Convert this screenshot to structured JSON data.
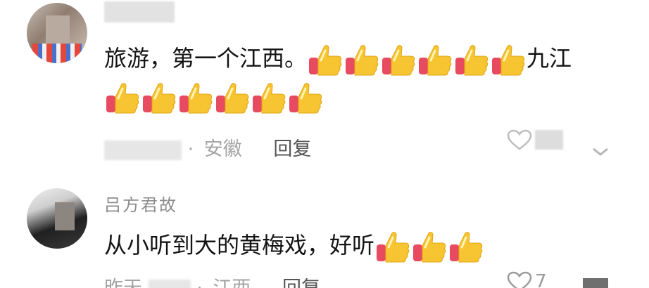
{
  "comments": [
    {
      "username": "",
      "text_parts": [
        "旅游，第一个江西。",
        "九江"
      ],
      "thumbs_before_jiujiang": 6,
      "thumbs_after_jiujiang": 6,
      "time": "",
      "dot": "·",
      "location": "安徽",
      "reply_label": "回复",
      "likes": ""
    },
    {
      "username": "吕方君故",
      "text": "从小听到大的黄梅戏，好听",
      "thumbs_after": 3,
      "time": "昨天",
      "dot": "·",
      "location": "江西",
      "reply_label": "回复",
      "likes": "7"
    }
  ],
  "icons": {
    "thumbs_up": "thumbs-up-emoji",
    "like": "heart-outline-icon",
    "collapse": "chevron-down-icon"
  },
  "colors": {
    "thumb_yellow": "#F7C531",
    "thumb_cuff": "#E84A5F",
    "meta_gray": "#A3A3A3",
    "text": "#141414"
  }
}
